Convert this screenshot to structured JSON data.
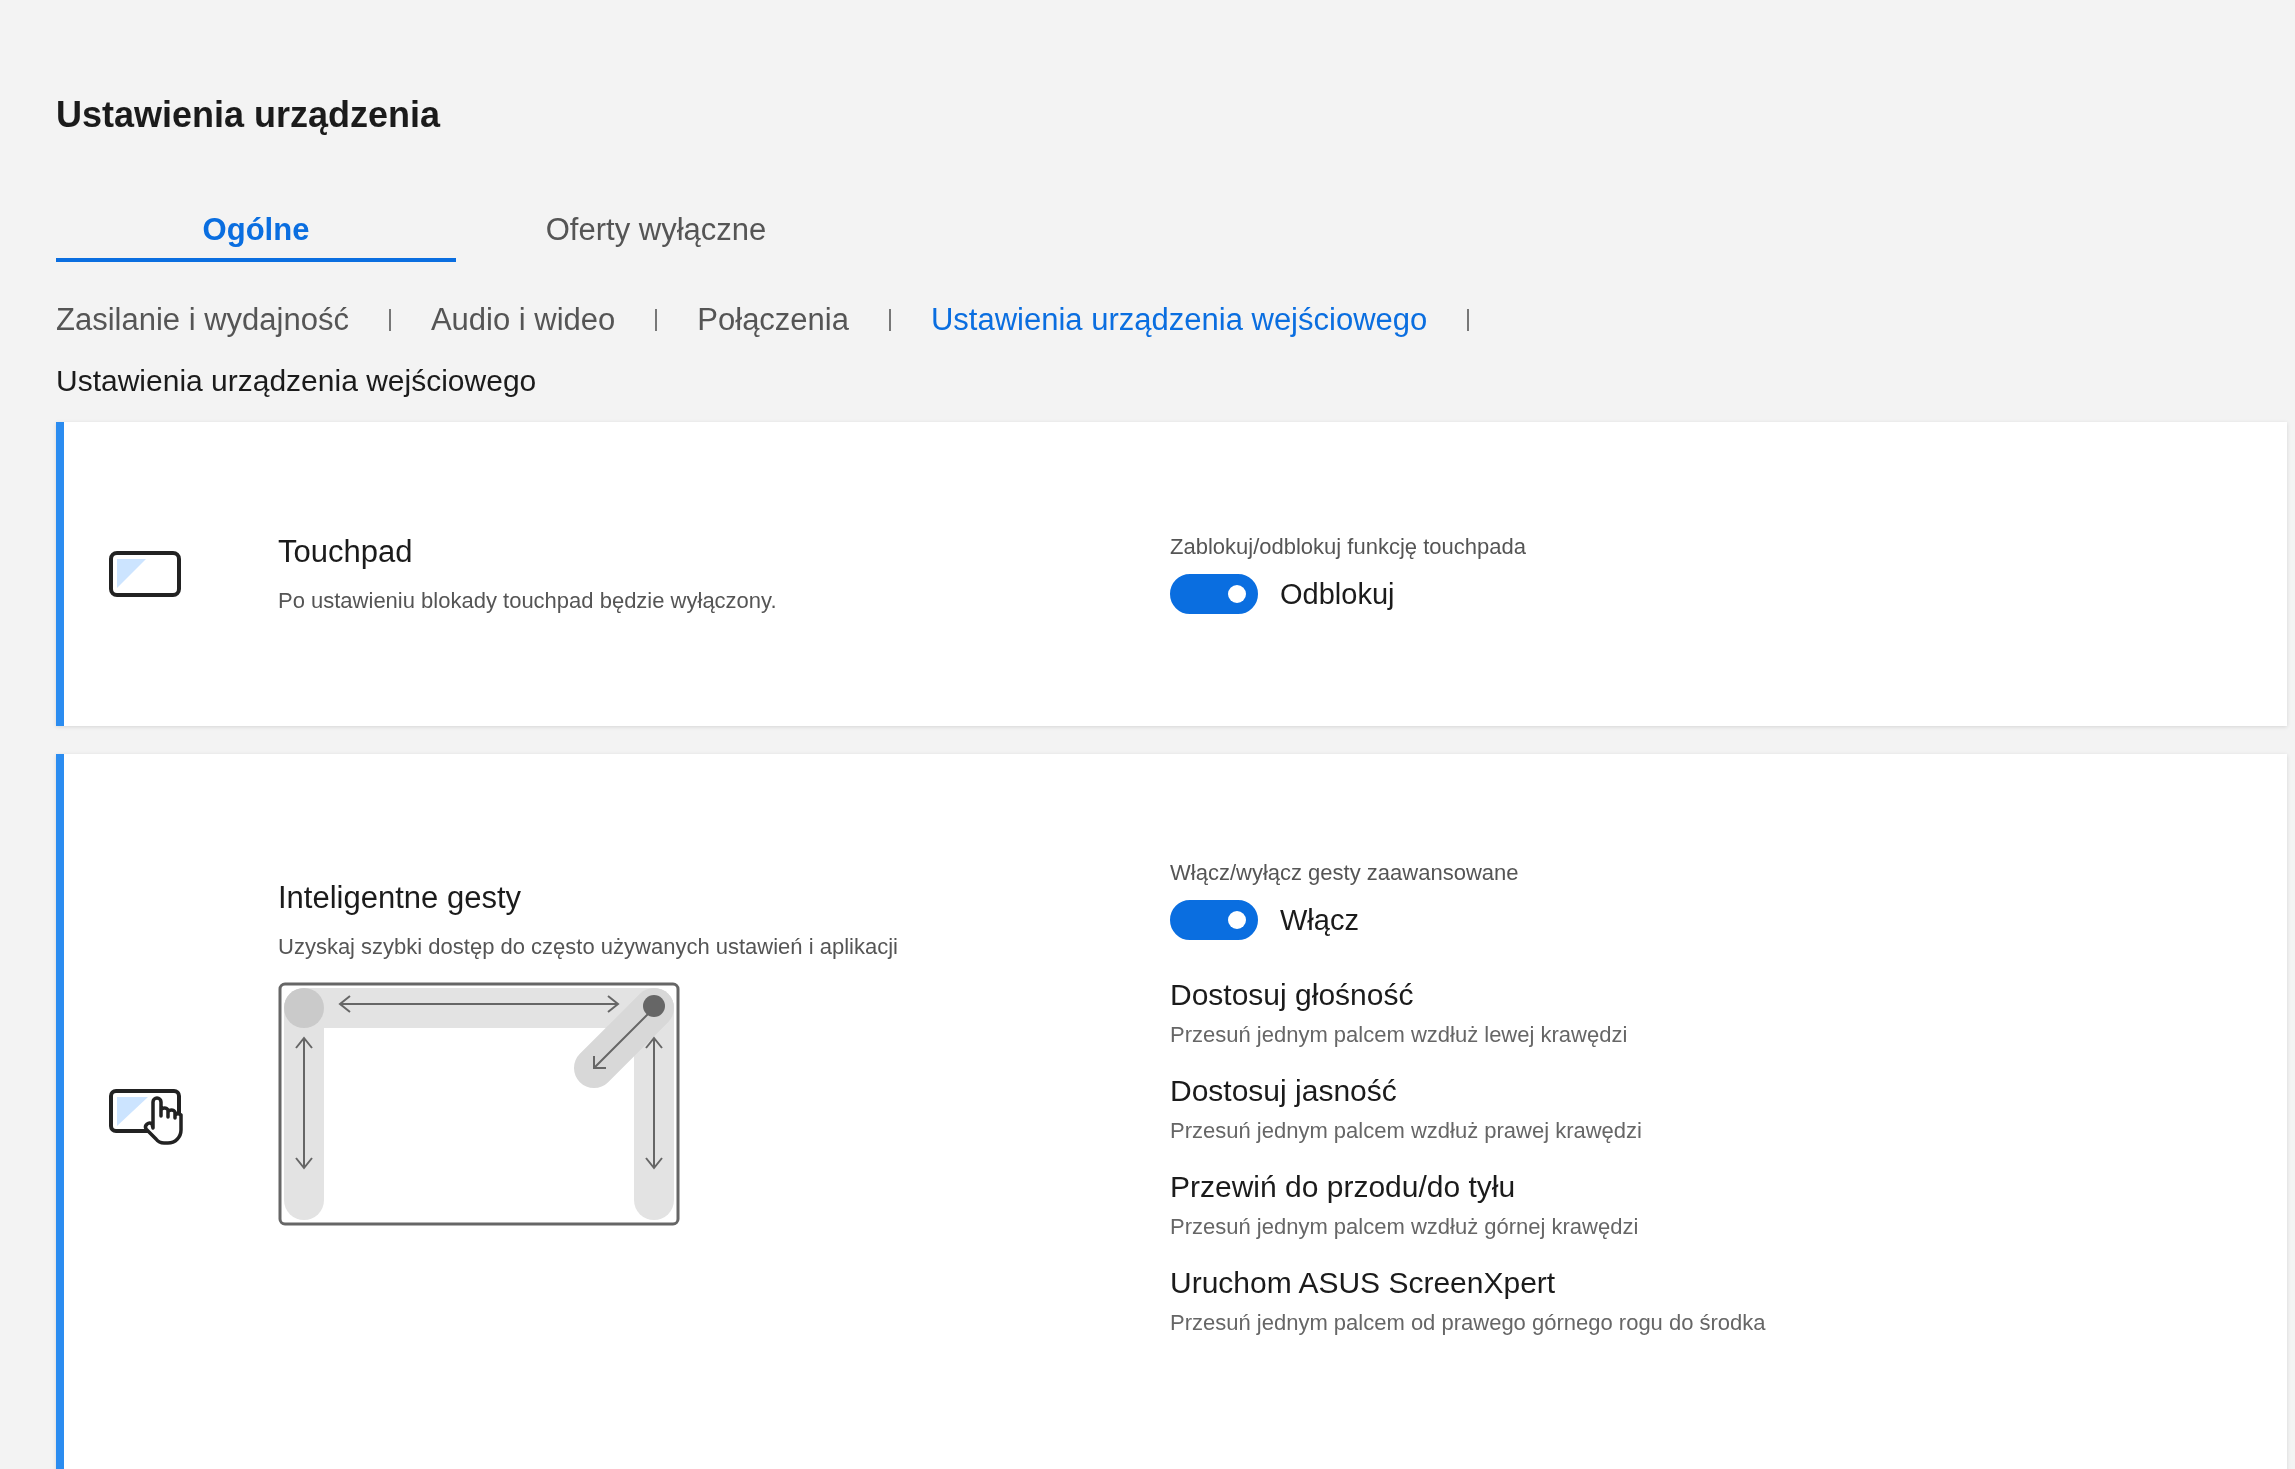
{
  "page": {
    "title": "Ustawienia urządzenia"
  },
  "tabs": [
    {
      "label": "Ogólne",
      "selected": true
    },
    {
      "label": "Oferty wyłączne",
      "selected": false
    }
  ],
  "subnav": [
    {
      "label": "Zasilanie i wydajność",
      "selected": false
    },
    {
      "label": "Audio i wideo",
      "selected": false
    },
    {
      "label": "Połączenia",
      "selected": false
    },
    {
      "label": "Ustawienia urządzenia wejściowego",
      "selected": true
    }
  ],
  "section_title": "Ustawienia urządzenia wejściowego",
  "cards": [
    {
      "kind": "touchpad",
      "title": "Touchpad",
      "description": "Po ustawieniu blokady touchpad będzie wyłączony.",
      "toggle": {
        "label": "Zablokuj/odblokuj funkcję touchpada",
        "on": true,
        "state_label": "Odblokuj"
      }
    },
    {
      "kind": "gestures",
      "title": "Inteligentne gesty",
      "description": "Uzyskaj szybki dostęp do często używanych ustawień i aplikacji",
      "toggle": {
        "label": "Włącz/wyłącz gesty zaawansowane",
        "on": true,
        "state_label": "Włącz"
      },
      "gestures": [
        {
          "title": "Dostosuj głośność",
          "description": "Przesuń jednym palcem wzdłuż lewej krawędzi"
        },
        {
          "title": "Dostosuj jasność",
          "description": "Przesuń jednym palcem wzdłuż prawej krawędzi"
        },
        {
          "title": "Przewiń do przodu/do tyłu",
          "description": "Przesuń jednym palcem wzdłuż górnej krawędzi"
        },
        {
          "title": "Uruchom ASUS ScreenXpert",
          "description": "Przesuń jednym palcem od prawego górnego rogu do środka"
        }
      ]
    }
  ]
}
